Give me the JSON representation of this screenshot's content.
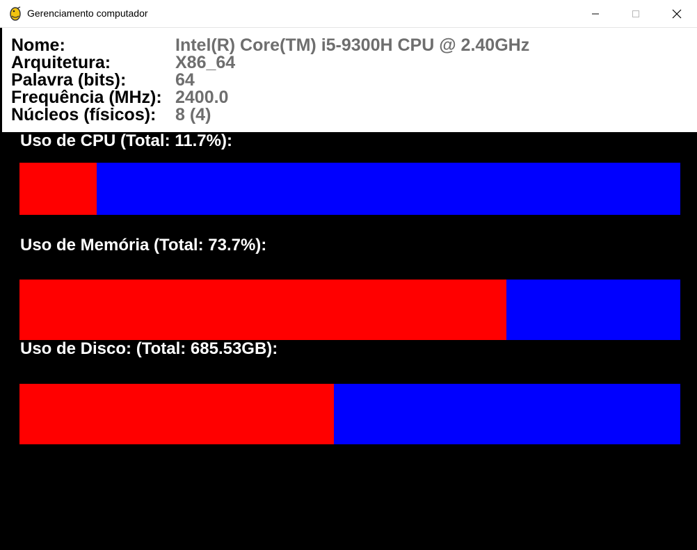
{
  "window": {
    "title": "Gerenciamento computador",
    "icon": "python-snake-icon",
    "controls": [
      "minimize-icon",
      "maximize-icon",
      "close-icon"
    ]
  },
  "info": {
    "rows": [
      {
        "label": "Nome:",
        "value": "Intel(R) Core(TM) i5-9300H CPU @ 2.40GHz"
      },
      {
        "label": "Arquitetura:",
        "value": "X86_64"
      },
      {
        "label": "Palavra (bits):",
        "value": "64"
      },
      {
        "label": "Frequência (MHz):",
        "value": "2400.0"
      },
      {
        "label": "Núcleos (físicos):",
        "value": "8 (4)"
      }
    ]
  },
  "usage": {
    "cpu": {
      "label": "Uso de CPU (Total: 11.7%):",
      "fill_fraction": 0.117
    },
    "memory": {
      "label": "Uso de Memória (Total: 73.7%):",
      "fill_fraction": 0.737
    },
    "disk": {
      "label": "Uso de Disco: (Total: 685.53GB):",
      "fill_fraction": 0.476
    }
  },
  "colors": {
    "used": "#ff0000",
    "free": "#0000ff",
    "background": "#000000",
    "value_text": "#6e6e6e"
  }
}
